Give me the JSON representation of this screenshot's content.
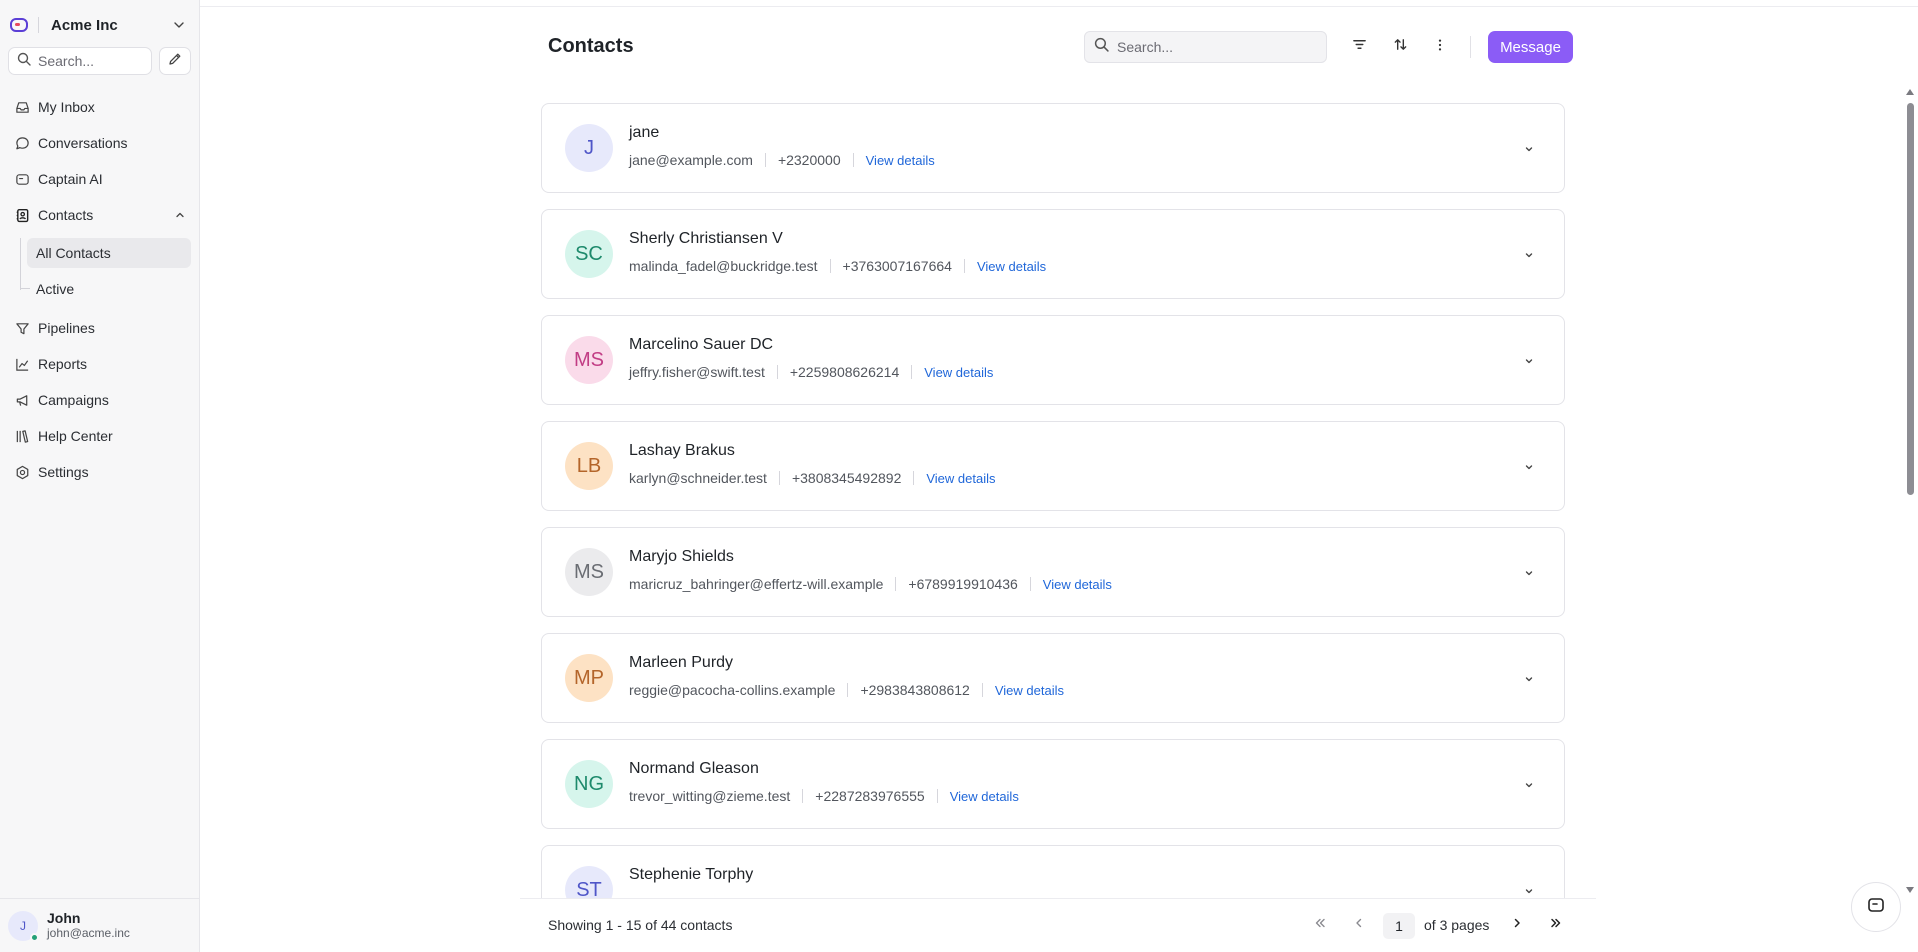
{
  "workspace": {
    "name": "Acme Inc"
  },
  "sidebar": {
    "search_placeholder": "Search...",
    "items": [
      {
        "label": "My Inbox",
        "icon": "inbox-icon"
      },
      {
        "label": "Conversations",
        "icon": "chat-bubble-icon"
      },
      {
        "label": "Captain AI",
        "icon": "bot-icon"
      },
      {
        "label": "Contacts",
        "icon": "contacts-book-icon",
        "expanded": true,
        "children": [
          {
            "label": "All Contacts",
            "active": true
          },
          {
            "label": "Active"
          }
        ]
      },
      {
        "label": "Pipelines",
        "icon": "funnel-icon"
      },
      {
        "label": "Reports",
        "icon": "line-chart-icon"
      },
      {
        "label": "Campaigns",
        "icon": "megaphone-icon"
      },
      {
        "label": "Help Center",
        "icon": "library-icon"
      },
      {
        "label": "Settings",
        "icon": "gear-icon"
      }
    ],
    "user": {
      "initial": "J",
      "name": "John",
      "email": "john@acme.inc",
      "status_color": "#24a077"
    }
  },
  "header": {
    "title": "Contacts",
    "search_placeholder": "Search...",
    "message_label": "Message",
    "accent": "#8b5cf6"
  },
  "contacts": [
    {
      "initials": "J",
      "name": "jane",
      "email": "jane@example.com",
      "phone": "+2320000",
      "link": "View details",
      "bg": "#e7e9fb",
      "fg": "#4f56c8"
    },
    {
      "initials": "SC",
      "name": "Sherly Christiansen V",
      "email": "malinda_fadel@buckridge.test",
      "phone": "+3763007167664",
      "link": "View details",
      "bg": "#d6f5ec",
      "fg": "#1e8a6c"
    },
    {
      "initials": "MS",
      "name": "Marcelino Sauer DC",
      "email": "jeffry.fisher@swift.test",
      "phone": "+2259808626214",
      "link": "View details",
      "bg": "#fadbea",
      "fg": "#c23d85"
    },
    {
      "initials": "LB",
      "name": "Lashay Brakus",
      "email": "karlyn@schneider.test",
      "phone": "+3808345492892",
      "link": "View details",
      "bg": "#fde2c4",
      "fg": "#b4652a"
    },
    {
      "initials": "MS",
      "name": "Maryjo Shields",
      "email": "maricruz_bahringer@effertz-will.example",
      "phone": "+6789919910436",
      "link": "View details",
      "bg": "#ebebed",
      "fg": "#6a6d73"
    },
    {
      "initials": "MP",
      "name": "Marleen Purdy",
      "email": "reggie@pacocha-collins.example",
      "phone": "+2983843808612",
      "link": "View details",
      "bg": "#fde2c4",
      "fg": "#b4652a"
    },
    {
      "initials": "NG",
      "name": "Normand Gleason",
      "email": "trevor_witting@zieme.test",
      "phone": "+2287283976555",
      "link": "View details",
      "bg": "#d6f5ec",
      "fg": "#1e8a6c"
    },
    {
      "initials": "ST",
      "name": "Stephenie Torphy",
      "email": "",
      "phone": "",
      "link": "",
      "bg": "#e7e9fb",
      "fg": "#4f56c8"
    }
  ],
  "footer": {
    "summary": "Showing 1 - 15 of 44 contacts",
    "current_page": "1",
    "of_pages": "of 3 pages"
  }
}
